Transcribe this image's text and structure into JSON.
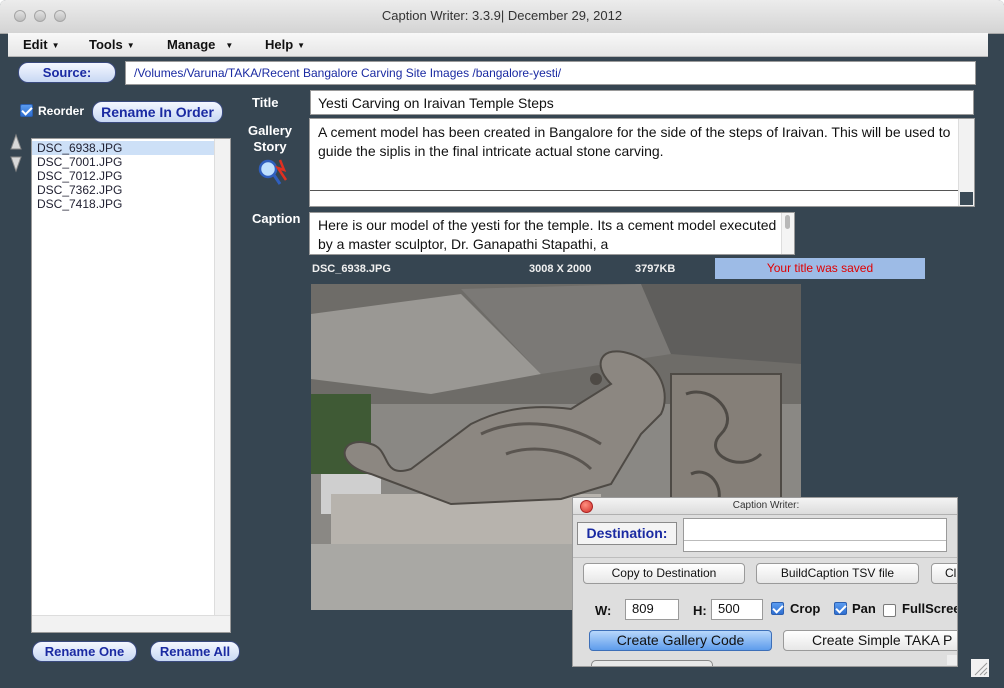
{
  "window": {
    "title": "Caption Writer: 3.3.9| December 29, 2012"
  },
  "menu": {
    "edit": "Edit",
    "tools": "Tools",
    "manage": "Manage",
    "help": "Help"
  },
  "source": {
    "button": "Source:",
    "path": "/Volumes/Varuna/TAKA/Recent Bangalore Carving Site Images /bangalore-yesti/"
  },
  "left": {
    "reorder_label": "Reorder",
    "reorder_checked": true,
    "rename_in_order": "Rename In Order",
    "files": [
      "DSC_6938.JPG",
      "DSC_7001.JPG",
      "DSC_7012.JPG",
      "DSC_7362.JPG",
      "DSC_7418.JPG"
    ],
    "selected_index": 0,
    "rename_one": "Rename One",
    "rename_all": "Rename All"
  },
  "form": {
    "title_label": "Title",
    "title_value": "Yesti Carving on Iraivan Temple Steps",
    "gallery_label": "Gallery",
    "story_label": "Story",
    "gallery_story_value": "A cement model has been created in Bangalore for the side of the steps of Iraivan. This will be used to guide the siplis in the final intricate actual stone carving.",
    "caption_label": "Caption",
    "caption_value": "Here is our model of the yesti for the temple. Its a cement model executed by a master sculptor, Dr. Ganapathi Stapathi, a"
  },
  "image_info": {
    "filename": "DSC_6938.JPG",
    "dimensions": "3008 X 2000",
    "size": "3797KB",
    "status": "Your title was saved"
  },
  "dialog": {
    "title": "Caption Writer:",
    "destination_button": "Destination:",
    "destination_value": "",
    "copy_button": "Copy to Destination",
    "build_button": "BuildCaption TSV file",
    "cl_button": "Cl",
    "w_label": "W:",
    "w_value": "809",
    "h_label": "H:",
    "h_value": "500",
    "crop_label": "Crop",
    "crop_checked": true,
    "pan_label": "Pan",
    "pan_checked": true,
    "fullscreen_label": "FullScree",
    "fullscreen_checked": false,
    "gallery_code_button": "Create Gallery Code",
    "simple_button": "Create Simple TAKA P"
  },
  "colors": {
    "window_bg": "#364551",
    "status_bg": "#9dbbe6",
    "status_text": "#e00000",
    "link_text": "#1a2aa2"
  }
}
